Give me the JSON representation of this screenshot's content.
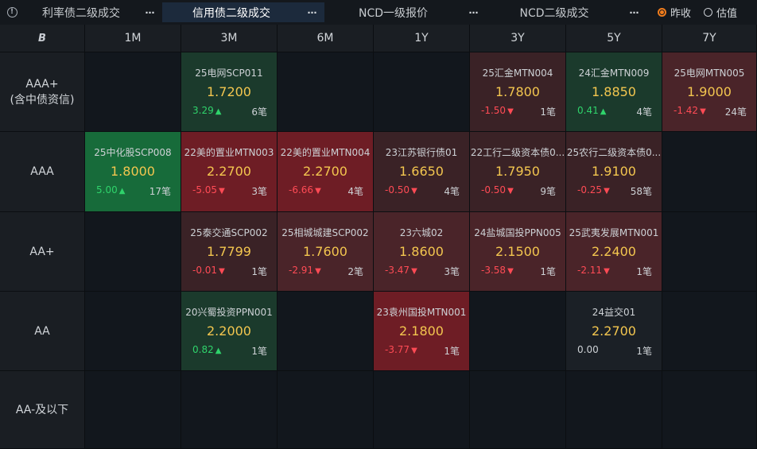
{
  "tabs": [
    {
      "label": "利率债二级成交",
      "active": false
    },
    {
      "label": "信用债二级成交",
      "active": true
    },
    {
      "label": "NCD一级报价",
      "active": false
    },
    {
      "label": "NCD二级成交",
      "active": false
    }
  ],
  "more_label": "⋯",
  "radio_options": [
    {
      "label": "昨收",
      "checked": true
    },
    {
      "label": "估值",
      "checked": false
    }
  ],
  "corner_icon": "B",
  "columns": [
    "1M",
    "3M",
    "6M",
    "1Y",
    "3Y",
    "5Y",
    "7Y"
  ],
  "rows": [
    {
      "label_lines": [
        "AAA+",
        "(含中债资信)"
      ]
    },
    {
      "label_lines": [
        "AAA"
      ]
    },
    {
      "label_lines": [
        "AA+"
      ]
    },
    {
      "label_lines": [
        "AA"
      ]
    },
    {
      "label_lines": [
        "AA-及以下"
      ]
    }
  ],
  "cells": [
    [
      null,
      {
        "name": "25电网SCP011",
        "rate": "1.7200",
        "change": "3.29",
        "dir": "up",
        "count": "6笔",
        "tone": "green"
      },
      null,
      null,
      {
        "name": "25汇金MTN004",
        "rate": "1.7800",
        "change": "-1.50",
        "dir": "down",
        "count": "1笔",
        "tone": "red-weak"
      },
      {
        "name": "24汇金MTN009",
        "rate": "1.8850",
        "change": "0.41",
        "dir": "up",
        "count": "4笔",
        "tone": "green"
      },
      {
        "name": "25电网MTN005",
        "rate": "1.9000",
        "change": "-1.42",
        "dir": "down",
        "count": "24笔",
        "tone": "red"
      }
    ],
    [
      {
        "name": "25中化股SCP008",
        "rate": "1.8000",
        "change": "5.00",
        "dir": "up",
        "count": "17笔",
        "tone": "green-strong"
      },
      {
        "name": "22美的置业MTN003",
        "rate": "2.2700",
        "change": "-5.05",
        "dir": "down",
        "count": "3笔",
        "tone": "red-strong"
      },
      {
        "name": "22美的置业MTN004",
        "rate": "2.2700",
        "change": "-6.66",
        "dir": "down",
        "count": "4笔",
        "tone": "red-strong"
      },
      {
        "name": "23江苏银行债01",
        "rate": "1.6650",
        "change": "-0.50",
        "dir": "down",
        "count": "4笔",
        "tone": "red-weak"
      },
      {
        "name": "22工行二级资本债0...",
        "rate": "1.7950",
        "change": "-0.50",
        "dir": "down",
        "count": "9笔",
        "tone": "red-weak"
      },
      {
        "name": "25农行二级资本债0...",
        "rate": "1.9100",
        "change": "-0.25",
        "dir": "down",
        "count": "58笔",
        "tone": "red-weak"
      },
      null
    ],
    [
      null,
      {
        "name": "25泰交通SCP002",
        "rate": "1.7799",
        "change": "-0.01",
        "dir": "down",
        "count": "1笔",
        "tone": "red-weak"
      },
      {
        "name": "25相城城建SCP002",
        "rate": "1.7600",
        "change": "-2.91",
        "dir": "down",
        "count": "2笔",
        "tone": "red"
      },
      {
        "name": "23六城02",
        "rate": "1.8600",
        "change": "-3.47",
        "dir": "down",
        "count": "3笔",
        "tone": "red"
      },
      {
        "name": "24盐城国投PPN005",
        "rate": "2.1500",
        "change": "-3.58",
        "dir": "down",
        "count": "1笔",
        "tone": "red"
      },
      {
        "name": "25武夷发展MTN001",
        "rate": "2.2400",
        "change": "-2.11",
        "dir": "down",
        "count": "1笔",
        "tone": "red"
      },
      null
    ],
    [
      null,
      {
        "name": "20兴蜀投资PPN001",
        "rate": "2.2000",
        "change": "0.82",
        "dir": "up",
        "count": "1笔",
        "tone": "green"
      },
      null,
      {
        "name": "23袁州国投MTN001",
        "rate": "2.1800",
        "change": "-3.77",
        "dir": "down",
        "count": "1笔",
        "tone": "red-strong"
      },
      null,
      {
        "name": "24益交01",
        "rate": "2.2700",
        "change": "0.00",
        "dir": "flat",
        "count": "1笔",
        "tone": "neutral"
      },
      null
    ],
    [
      null,
      null,
      null,
      null,
      null,
      null,
      null
    ]
  ],
  "colors": {
    "rate": "#f3c64f",
    "up": "#2fd36b",
    "down": "#ff4b55",
    "radio_accent": "#f07c1c"
  }
}
